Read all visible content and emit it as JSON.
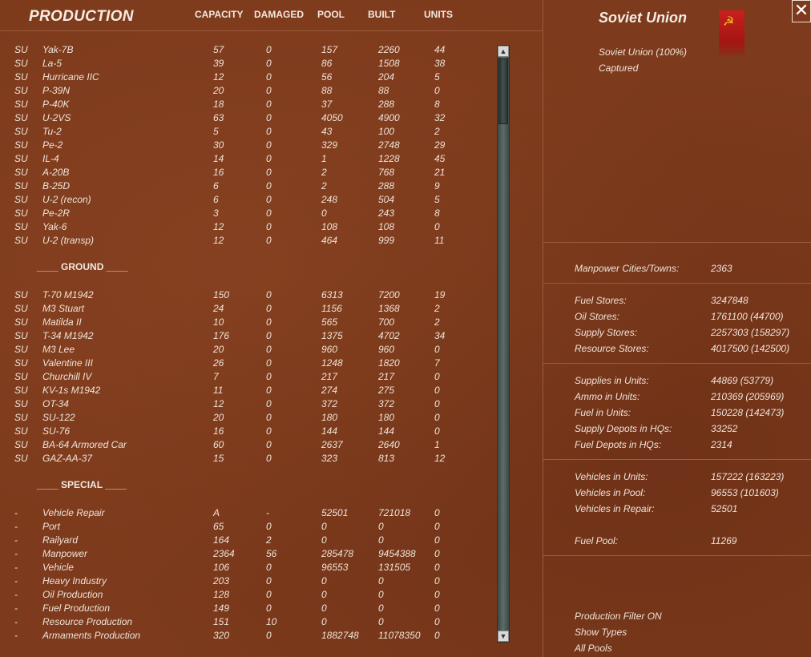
{
  "production": {
    "title": "PRODUCTION",
    "columns": {
      "capacity": "CAPACITY",
      "damaged": "DAMAGED",
      "pool": "POOL",
      "built": "BUILT",
      "units": "UNITS"
    },
    "air_rows": [
      {
        "nat": "SU",
        "name": "Yak-7B",
        "capacity": "57",
        "damaged": "0",
        "pool": "157",
        "built": "2260",
        "units": "44"
      },
      {
        "nat": "SU",
        "name": "La-5",
        "capacity": "39",
        "damaged": "0",
        "pool": "86",
        "built": "1508",
        "units": "38"
      },
      {
        "nat": "SU",
        "name": "Hurricane IIC",
        "capacity": "12",
        "damaged": "0",
        "pool": "56",
        "built": "204",
        "units": "5"
      },
      {
        "nat": "SU",
        "name": "P-39N",
        "capacity": "20",
        "damaged": "0",
        "pool": "88",
        "built": "88",
        "units": "0"
      },
      {
        "nat": "SU",
        "name": "P-40K",
        "capacity": "18",
        "damaged": "0",
        "pool": "37",
        "built": "288",
        "units": "8"
      },
      {
        "nat": "SU",
        "name": "U-2VS",
        "capacity": "63",
        "damaged": "0",
        "pool": "4050",
        "built": "4900",
        "units": "32"
      },
      {
        "nat": "SU",
        "name": "Tu-2",
        "capacity": "5",
        "damaged": "0",
        "pool": "43",
        "built": "100",
        "units": "2"
      },
      {
        "nat": "SU",
        "name": "Pe-2",
        "capacity": "30",
        "damaged": "0",
        "pool": "329",
        "built": "2748",
        "units": "29"
      },
      {
        "nat": "SU",
        "name": "IL-4",
        "capacity": "14",
        "damaged": "0",
        "pool": "1",
        "built": "1228",
        "units": "45"
      },
      {
        "nat": "SU",
        "name": "A-20B",
        "capacity": "16",
        "damaged": "0",
        "pool": "2",
        "built": "768",
        "units": "21"
      },
      {
        "nat": "SU",
        "name": "B-25D",
        "capacity": "6",
        "damaged": "0",
        "pool": "2",
        "built": "288",
        "units": "9"
      },
      {
        "nat": "SU",
        "name": "U-2 (recon)",
        "capacity": "6",
        "damaged": "0",
        "pool": "248",
        "built": "504",
        "units": "5"
      },
      {
        "nat": "SU",
        "name": "Pe-2R",
        "capacity": "3",
        "damaged": "0",
        "pool": "0",
        "built": "243",
        "units": "8"
      },
      {
        "nat": "SU",
        "name": "Yak-6",
        "capacity": "12",
        "damaged": "0",
        "pool": "108",
        "built": "108",
        "units": "0"
      },
      {
        "nat": "SU",
        "name": "U-2 (transp)",
        "capacity": "12",
        "damaged": "0",
        "pool": "464",
        "built": "999",
        "units": "11"
      }
    ],
    "ground_header": "____ GROUND ____",
    "ground_rows": [
      {
        "nat": "SU",
        "name": "T-70 M1942",
        "capacity": "150",
        "damaged": "0",
        "pool": "6313",
        "built": "7200",
        "units": "19"
      },
      {
        "nat": "SU",
        "name": "M3 Stuart",
        "capacity": "24",
        "damaged": "0",
        "pool": "1156",
        "built": "1368",
        "units": "2"
      },
      {
        "nat": "SU",
        "name": "Matilda II",
        "capacity": "10",
        "damaged": "0",
        "pool": "565",
        "built": "700",
        "units": "2"
      },
      {
        "nat": "SU",
        "name": "T-34 M1942",
        "capacity": "176",
        "damaged": "0",
        "pool": "1375",
        "built": "4702",
        "units": "34"
      },
      {
        "nat": "SU",
        "name": "M3 Lee",
        "capacity": "20",
        "damaged": "0",
        "pool": "960",
        "built": "960",
        "units": "0"
      },
      {
        "nat": "SU",
        "name": "Valentine III",
        "capacity": "26",
        "damaged": "0",
        "pool": "1248",
        "built": "1820",
        "units": "7"
      },
      {
        "nat": "SU",
        "name": "Churchill IV",
        "capacity": "7",
        "damaged": "0",
        "pool": "217",
        "built": "217",
        "units": "0"
      },
      {
        "nat": "SU",
        "name": "KV-1s M1942",
        "capacity": "11",
        "damaged": "0",
        "pool": "274",
        "built": "275",
        "units": "0"
      },
      {
        "nat": "SU",
        "name": "OT-34",
        "capacity": "12",
        "damaged": "0",
        "pool": "372",
        "built": "372",
        "units": "0"
      },
      {
        "nat": "SU",
        "name": "SU-122",
        "capacity": "20",
        "damaged": "0",
        "pool": "180",
        "built": "180",
        "units": "0"
      },
      {
        "nat": "SU",
        "name": "SU-76",
        "capacity": "16",
        "damaged": "0",
        "pool": "144",
        "built": "144",
        "units": "0"
      },
      {
        "nat": "SU",
        "name": "BA-64 Armored Car",
        "capacity": "60",
        "damaged": "0",
        "pool": "2637",
        "built": "2640",
        "units": "1"
      },
      {
        "nat": "SU",
        "name": "GAZ-AA-37",
        "capacity": "15",
        "damaged": "0",
        "pool": "323",
        "built": "813",
        "units": "12"
      }
    ],
    "special_header": "____ SPECIAL ____",
    "special_rows": [
      {
        "nat": "-",
        "name": "Vehicle Repair",
        "capacity": "A",
        "damaged": "-",
        "pool": "52501",
        "built": "721018",
        "units": "0"
      },
      {
        "nat": "-",
        "name": "Port",
        "capacity": "65",
        "damaged": "0",
        "pool": "0",
        "built": "0",
        "units": "0"
      },
      {
        "nat": "-",
        "name": "Railyard",
        "capacity": "164",
        "damaged": "2",
        "pool": "0",
        "built": "0",
        "units": "0"
      },
      {
        "nat": "-",
        "name": "Manpower",
        "capacity": "2364",
        "damaged": "56",
        "pool": "285478",
        "built": "9454388",
        "units": "0"
      },
      {
        "nat": "-",
        "name": "Vehicle",
        "capacity": "106",
        "damaged": "0",
        "pool": "96553",
        "built": "131505",
        "units": "0"
      },
      {
        "nat": "-",
        "name": "Heavy Industry",
        "capacity": "203",
        "damaged": "0",
        "pool": "0",
        "built": "0",
        "units": "0"
      },
      {
        "nat": "-",
        "name": "Oil Production",
        "capacity": "128",
        "damaged": "0",
        "pool": "0",
        "built": "0",
        "units": "0"
      },
      {
        "nat": "-",
        "name": "Fuel Production",
        "capacity": "149",
        "damaged": "0",
        "pool": "0",
        "built": "0",
        "units": "0"
      },
      {
        "nat": "-",
        "name": "Resource Production",
        "capacity": "151",
        "damaged": "10",
        "pool": "0",
        "built": "0",
        "units": "0"
      },
      {
        "nat": "-",
        "name": "Armaments Production",
        "capacity": "320",
        "damaged": "0",
        "pool": "1882748",
        "built": "11078350",
        "units": "0"
      }
    ]
  },
  "nation": {
    "name": "Soviet Union",
    "control": "Soviet Union  (100%)",
    "status": "Captured"
  },
  "stats": {
    "manpower": [
      {
        "label": "Manpower Cities/Towns:",
        "value": "2363"
      }
    ],
    "stores": [
      {
        "label": "Fuel Stores:",
        "value": "3247848"
      },
      {
        "label": "Oil Stores:",
        "value": "1761100 (44700)"
      },
      {
        "label": "Supply Stores:",
        "value": "2257303 (158297)"
      },
      {
        "label": "Resource Stores:",
        "value": "4017500 (142500)"
      }
    ],
    "units": [
      {
        "label": "Supplies in Units:",
        "value": "44869 (53779)"
      },
      {
        "label": "Ammo in Units:",
        "value": "210369 (205969)"
      },
      {
        "label": "Fuel in Units:",
        "value": "150228 (142473)"
      },
      {
        "label": "Supply Depots in HQs:",
        "value": "33252"
      },
      {
        "label": "Fuel Depots in HQs:",
        "value": "2314"
      }
    ],
    "vehicles": [
      {
        "label": "Vehicles in Units:",
        "value": "157222 (163223)"
      },
      {
        "label": "Vehicles in Pool:",
        "value": "96553 (101603)"
      },
      {
        "label": "Vehicles in Repair:",
        "value": "52501"
      }
    ],
    "fuel_pool": {
      "label": "Fuel Pool:",
      "value": "11269"
    }
  },
  "footer": {
    "filter": "Production Filter ON",
    "show_types": "Show Types",
    "all_pools": "All Pools"
  },
  "buttons": {
    "close": "✕",
    "scroll_up": "▲",
    "scroll_down": "▼"
  },
  "flag": {
    "emblem": "☭",
    "color": "#c8201e"
  },
  "icons": {
    "close": "close-icon",
    "flag": "soviet-flag-icon"
  }
}
